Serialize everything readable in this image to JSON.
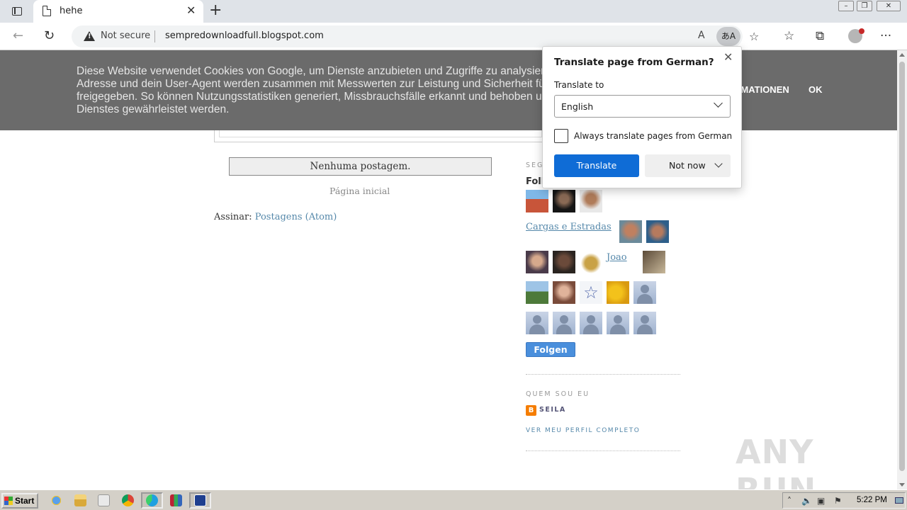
{
  "browser": {
    "tab_title": "hehe",
    "address": {
      "security_label": "Not secure",
      "url": "sempredownloadfull.blogspot.com"
    },
    "translate_icon_glyph": "あA",
    "icons": [
      "tab-actions-icon",
      "page-icon",
      "close-icon",
      "new-tab-icon",
      "back-icon",
      "refresh-icon",
      "warning-icon",
      "read-aloud-icon",
      "translate-icon",
      "add-favorite-icon",
      "favorites-icon",
      "collections-icon",
      "profile-icon",
      "more-icon"
    ]
  },
  "cookie_bar": {
    "lines": [
      "Diese Website verwendet Cookies von Google, um Dienste anzubieten und Zugriffe zu analysieren. Ihre IP-",
      "Adresse und dein User-Agent werden zusammen mit Messwerten zur Leistung und Sicherheit für Google",
      "freigegeben. So können Nutzungsstatistiken generiert, Missbrauchsfälle erkannt und behoben und die Qualität des",
      "Dienstes gewährleistet werden."
    ],
    "more_info_label": "RMATIONEN",
    "ok_label": "OK",
    "bg_color": "#6b6b6b"
  },
  "blog": {
    "no_posts": "Nenhuma postagem.",
    "home_link": "Página inicial",
    "subscribe_label": "Assinar:",
    "subscribe_link": "Postagens (Atom)"
  },
  "sidebar": {
    "followers_heading": "SEG",
    "followers_title": "Foll",
    "alt_links": [
      "Cargas e Estradas",
      "Joao"
    ],
    "follow_button": "Folgen",
    "about_heading": "QUEM SOU EU",
    "profile_name": "SEILA",
    "profile_link": "VER MEU PERFIL COMPLETO"
  },
  "translate_popup": {
    "title": "Translate page from  German?",
    "translate_to_label": "Translate to",
    "selected_language": "English",
    "always_translate_label": "Always translate pages from German",
    "always_translate_checked": false,
    "translate_button": "Translate",
    "not_now_button": "Not now",
    "accent_color": "#0f6cd6"
  },
  "watermark": "ANY RUN",
  "taskbar": {
    "start_label": "Start",
    "clock": "5:22 PM"
  }
}
